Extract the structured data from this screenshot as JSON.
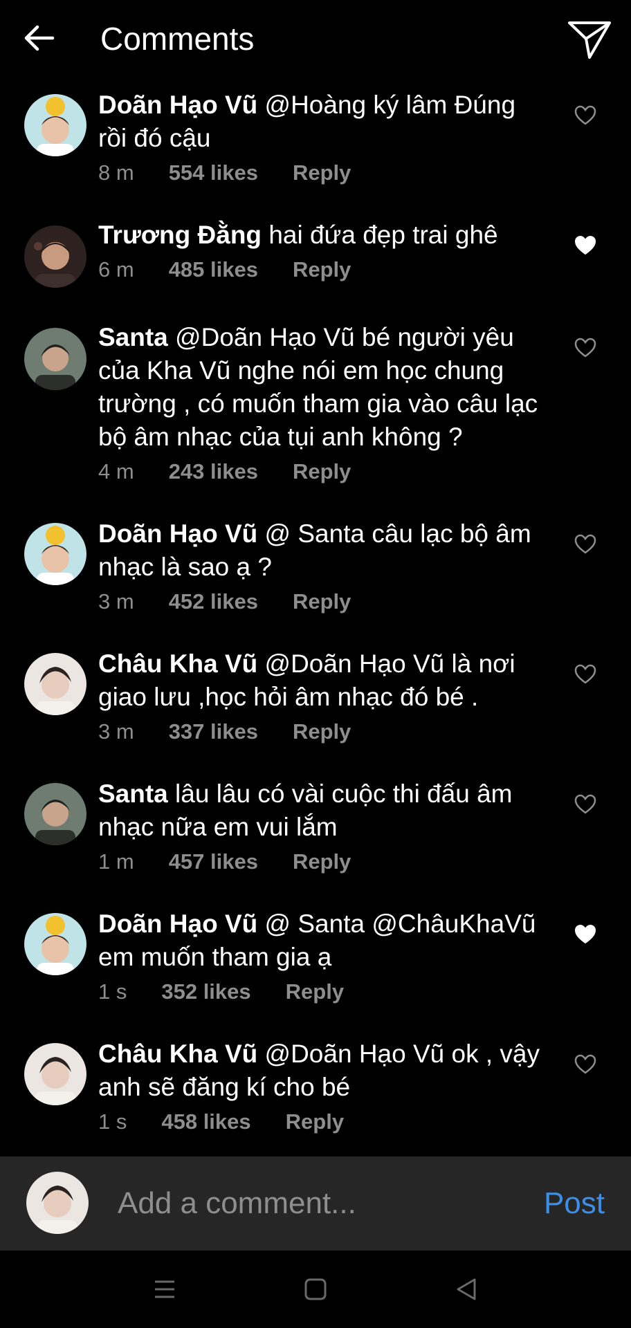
{
  "header": {
    "title": "Comments"
  },
  "comments": [
    {
      "name": "Doãn Hạo Vũ",
      "text": "@Hoàng ký lâm Đúng rồi đó cậu",
      "time": "8 m",
      "likes": "554 likes",
      "reply": "Reply",
      "liked": false
    },
    {
      "name": "Trương Đằng",
      "text": "hai đứa đẹp trai ghê",
      "time": "6 m",
      "likes": "485 likes",
      "reply": "Reply",
      "liked": true
    },
    {
      "name": "Santa",
      "text": "@Doãn Hạo Vũ bé người yêu của Kha Vũ nghe nói em học chung trường , có muốn tham gia vào câu lạc bộ âm nhạc của tụi anh không ?",
      "time": "4 m",
      "likes": "243 likes",
      "reply": "Reply",
      "liked": false
    },
    {
      "name": "Doãn Hạo Vũ",
      "text": "@ Santa câu lạc bộ âm nhạc là sao ạ ?",
      "time": "3 m",
      "likes": "452 likes",
      "reply": "Reply",
      "liked": false
    },
    {
      "name": "Châu Kha Vũ",
      "text": "@Doãn Hạo Vũ là nơi giao lưu ,học hỏi âm nhạc đó bé .",
      "time": "3 m",
      "likes": "337 likes",
      "reply": "Reply",
      "liked": false
    },
    {
      "name": "Santa",
      "text": "lâu lâu có vài cuộc thi đấu âm nhạc nữa em vui lắm",
      "time": "1 m",
      "likes": "457 likes",
      "reply": "Reply",
      "liked": false
    },
    {
      "name": "Doãn Hạo Vũ",
      "text": "@ Santa @ChâuKhaVũ em muốn tham gia ạ",
      "time": "1 s",
      "likes": "352 likes",
      "reply": "Reply",
      "liked": true
    },
    {
      "name": "Châu Kha Vũ",
      "text": "@Doãn Hạo Vũ ok , vậy anh sẽ đăng kí cho bé",
      "time": "1 s",
      "likes": "458 likes",
      "reply": "Reply",
      "liked": false
    }
  ],
  "composer": {
    "placeholder": "Add a comment...",
    "post_label": "Post"
  },
  "colors": {
    "background": "#000000",
    "muted": "#8e8e8e",
    "accent": "#3d8ee6",
    "composer_bg": "#262626"
  },
  "icons": {
    "back": "arrow-left-icon",
    "share": "paper-plane-icon",
    "like": "heart-icon",
    "nav_menu": "menu-icon",
    "nav_home": "square-icon",
    "nav_back": "triangle-back-icon"
  }
}
